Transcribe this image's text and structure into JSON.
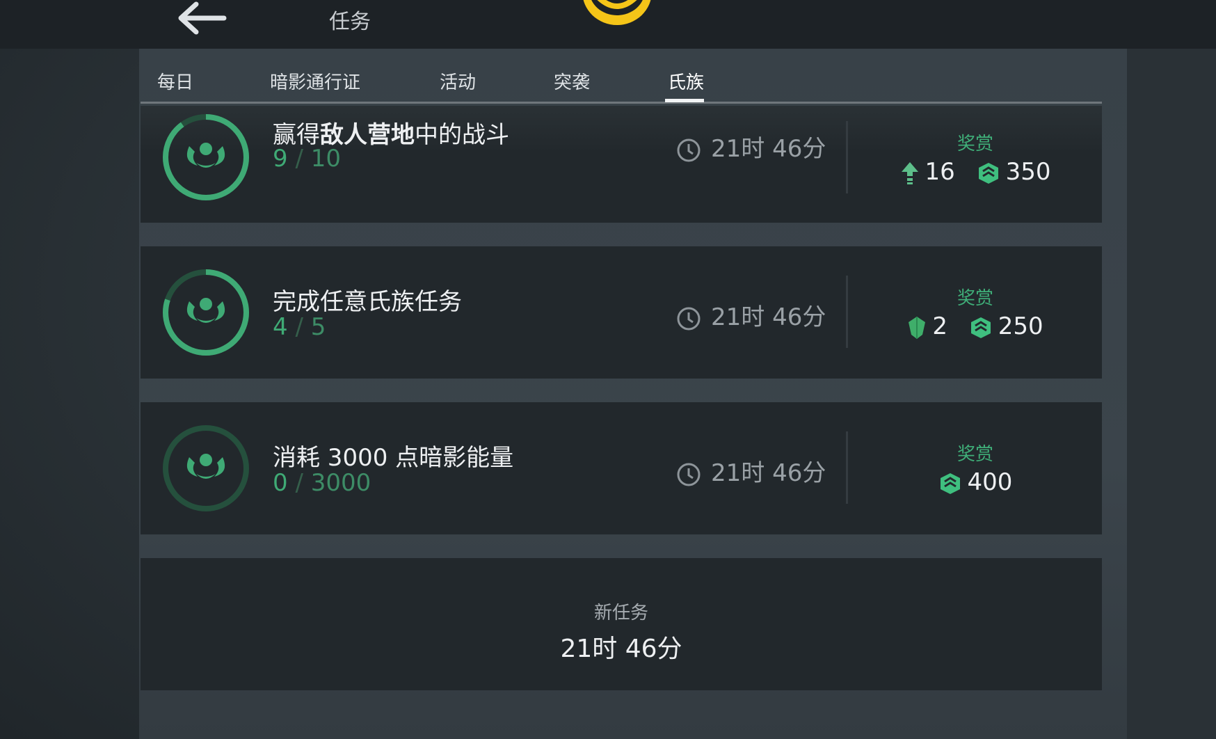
{
  "header": {
    "title": "任务"
  },
  "tabs": [
    {
      "label": "每日"
    },
    {
      "label": "暗影通行证"
    },
    {
      "label": "活动"
    },
    {
      "label": "突袭"
    },
    {
      "label": "氏族",
      "active": true
    }
  ],
  "tasks": [
    {
      "name_prefix": "赢得",
      "name_bold": "敌人营地",
      "name_suffix": "中的战斗",
      "progress_current": "9",
      "progress_separator": "/",
      "progress_total": "10",
      "progress_fraction": 0.9,
      "timer": "21时 46分",
      "reward_label": "奖赏",
      "rewards": [
        {
          "icon": "arrow-up-icon",
          "amount": "16"
        },
        {
          "icon": "clan-crest-icon",
          "amount": "350"
        }
      ]
    },
    {
      "name_prefix": "完成任意氏族任务",
      "name_bold": "",
      "name_suffix": "",
      "progress_current": "4",
      "progress_separator": "/",
      "progress_total": "5",
      "progress_fraction": 0.8,
      "timer": "21时 46分",
      "reward_label": "奖赏",
      "rewards": [
        {
          "icon": "green-gem-icon",
          "amount": "2"
        },
        {
          "icon": "clan-crest-icon",
          "amount": "250"
        }
      ]
    },
    {
      "name_prefix": "消耗 3000 点暗影能量",
      "name_bold": "",
      "name_suffix": "",
      "progress_current": "0",
      "progress_separator": "/",
      "progress_total": "3000",
      "progress_fraction": 0.0,
      "timer": "21时 46分",
      "reward_label": "奖赏",
      "rewards": [
        {
          "icon": "clan-crest-icon",
          "amount": "400"
        }
      ]
    }
  ],
  "new_task": {
    "label": "新任务",
    "timer": "21时 46分"
  },
  "colors": {
    "accent_green": "#3faa75",
    "emblem_yellow": "#f5c518"
  }
}
